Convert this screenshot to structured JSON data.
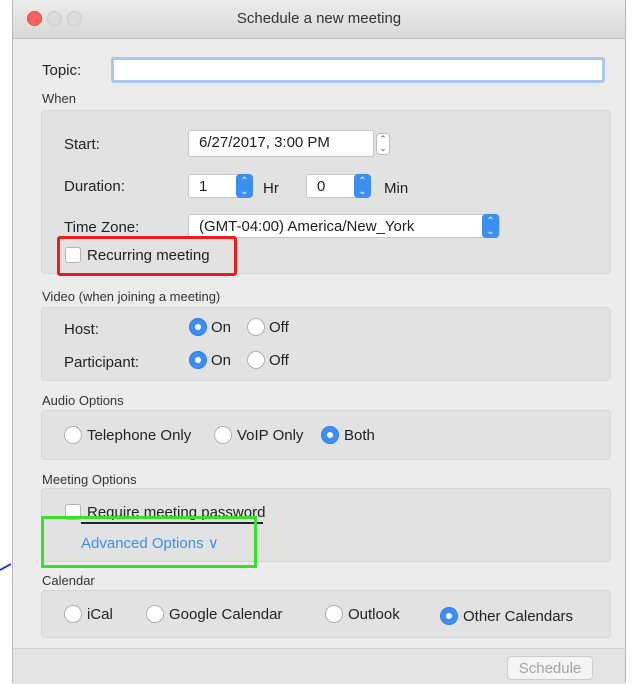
{
  "window": {
    "title": "Schedule a new meeting"
  },
  "topic": {
    "label": "Topic:",
    "value": ""
  },
  "when": {
    "section_label": "When",
    "start_label": "Start:",
    "start_value": "6/27/2017,  3:00 PM",
    "duration_label": "Duration:",
    "duration_hr_value": "1",
    "duration_hr_unit": "Hr",
    "duration_min_value": "0",
    "duration_min_unit": "Min",
    "timezone_label": "Time Zone:",
    "timezone_value": "(GMT-04:00) America/New_York",
    "recurring_label": "Recurring meeting"
  },
  "video": {
    "section_label": "Video (when joining a meeting)",
    "host_label": "Host:",
    "participant_label": "Participant:",
    "on_label": "On",
    "off_label": "Off",
    "host_selected": "On",
    "participant_selected": "On"
  },
  "audio": {
    "section_label": "Audio Options",
    "options": [
      "Telephone Only",
      "VoIP Only",
      "Both"
    ],
    "selected": "Both"
  },
  "meeting_options": {
    "section_label": "Meeting Options",
    "require_password_label": "Require meeting password",
    "advanced_label": "Advanced Options ∨"
  },
  "calendar": {
    "section_label": "Calendar",
    "options": [
      "iCal",
      "Google Calendar",
      "Outlook",
      "Other Calendars"
    ],
    "selected": "Other Calendars"
  },
  "footer": {
    "schedule_label": "Schedule"
  },
  "colors": {
    "accent": "#3b8ff0",
    "highlight_red": "#ee1c1c",
    "highlight_green": "#35e02f",
    "annotation_arrow": "#1f3fd0"
  }
}
